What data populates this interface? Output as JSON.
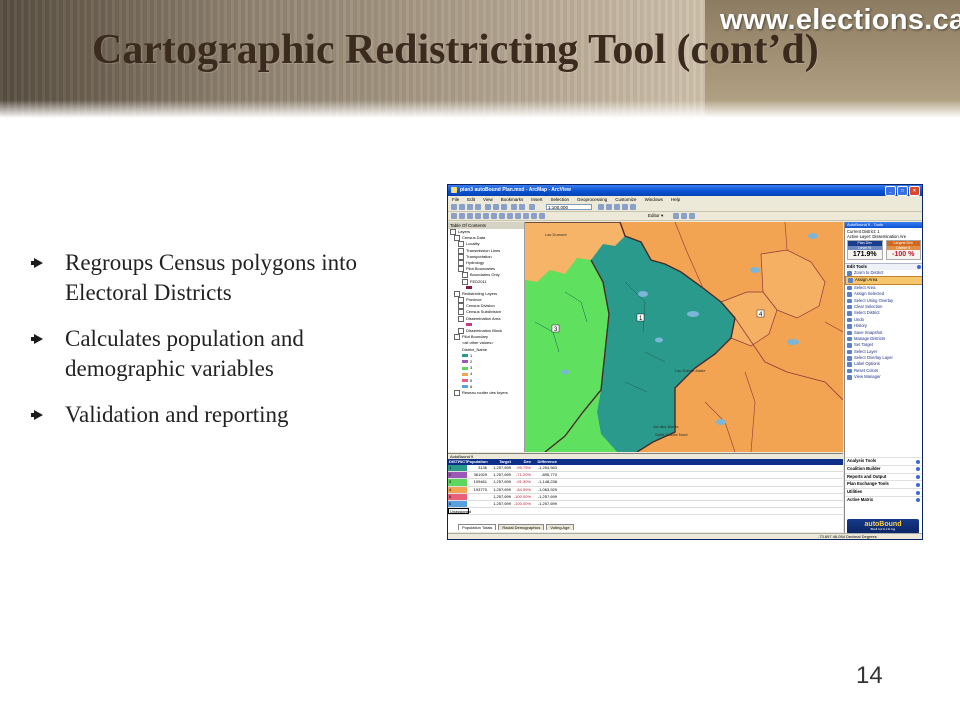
{
  "header": {
    "title": "Cartographic Redistricting Tool (cont’d)",
    "website": "www.elections.ca"
  },
  "bullets": [
    "Regroups Census polygons into Electoral Districts",
    "Calculates population and demographic variables",
    "Validation and reporting"
  ],
  "page_number": "14",
  "screenshot": {
    "window_title": "plan3 autoBound Plan.mxd - ArcMap - ArcView",
    "menu": [
      "File",
      "Edit",
      "View",
      "Bookmarks",
      "Insert",
      "Selection",
      "Geoprocessing",
      "Customize",
      "Windows",
      "Help"
    ],
    "scale": "1:100,000",
    "editor_label": "Editor ▾",
    "toc": {
      "title": "Table Of Contents",
      "rows": [
        "Layers",
        "Census Data",
        "Locality",
        "Transmission Lines",
        "Transportation",
        "Hydrology",
        "Pilot Boundaries",
        "Boundaries Only",
        "FED2011",
        "Redistricting Layers",
        "Province",
        "Census Division",
        "Census Subdivision",
        "Dissemination Area",
        "Dissemination Block",
        "Pilot Boundary",
        "<all other values>",
        "District_Name",
        "1",
        "2",
        "3",
        "4",
        "5",
        "6",
        "Reseau routier des foyers"
      ]
    },
    "map_labels": {
      "d1": "1",
      "d2": "2",
      "d3": "3",
      "d4": "4",
      "place1": "Lac-Sainte-Marie",
      "place2": "Val-des-Monts",
      "place3": "Saint-Calixte Nord",
      "place4": "Lac Dumont"
    },
    "panel": {
      "title": "AutoBound 9 - Tools",
      "current_district": "Current District: 1",
      "active_layer": "Active Layer:",
      "active_layer_value": "Dissemination Are",
      "plan_dev_label": "Plan Dev",
      "plan_dev_sub": "Level %",
      "plan_dev_value": "171.9%",
      "largest_dev_label": "Largest Dev",
      "largest_dev_sub": "District 5",
      "largest_dev_value": "-100 %",
      "edit_tools_label": "Edit Tools",
      "tools": [
        "Zoom to District",
        "Assign Area",
        "Select Area",
        "Assign Selected",
        "Select Using Overlay",
        "Clear Selection",
        "Select District",
        "Undo",
        "History",
        "Save Snapshot",
        "Manage Districts",
        "Set Target",
        "Select Layer",
        "Select Overlay Layer",
        "Label Options",
        "Reset Colors",
        "View Manager"
      ],
      "selected_tool": "Assign Area",
      "bottom_tools": [
        "Analysis Tools",
        "Coalition Builder",
        "Reports and Output",
        "Plan Exchange Tools",
        "Utilities",
        "Active Matrix"
      ],
      "logo": "autoBound",
      "logo_sub": "Redistricting"
    },
    "grid": {
      "title": "AutoBound 9",
      "headers": [
        "DISTRICT",
        "Population",
        "Target",
        "Dev",
        "Difference"
      ],
      "rows": [
        [
          "1",
          "3136",
          "1,257,699",
          "-99.75%",
          "-1,254,563"
        ],
        [
          "2",
          "361929",
          "1,257,699",
          "-71.20%",
          "-895,770"
        ],
        [
          "3",
          "109461",
          "1,257,699",
          "-91.30%",
          "-1,148,238"
        ],
        [
          "4",
          "193770",
          "1,257,699",
          "-84.59%",
          "-1,063,929"
        ],
        [
          "5",
          "",
          "1,257,699",
          "-100.00%",
          "-1,257,699"
        ],
        [
          "6",
          "",
          "1,257,699",
          "-100.00%",
          "-1,257,699"
        ],
        [
          "Unassigned",
          "",
          "",
          "",
          ""
        ]
      ],
      "tabs": [
        "Population Totals",
        "Racial Demographics",
        "Voting Age"
      ]
    },
    "status_coordinates": "-73.697  46.054 Decimal Degrees"
  }
}
